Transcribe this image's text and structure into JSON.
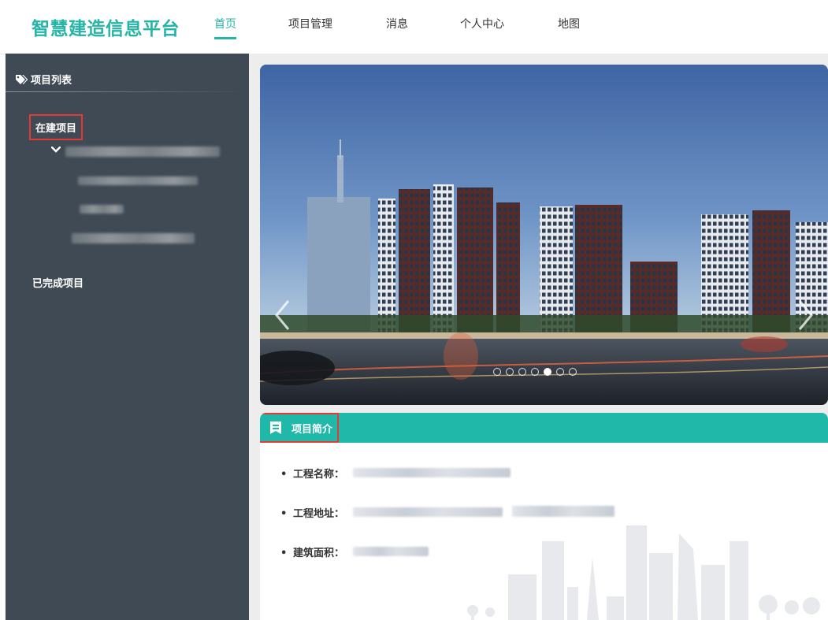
{
  "app": {
    "title": "智慧建造信息平台"
  },
  "nav": {
    "items": [
      {
        "label": "首页",
        "active": true
      },
      {
        "label": "项目管理"
      },
      {
        "label": "消息"
      },
      {
        "label": "个人中心"
      },
      {
        "label": "地图"
      }
    ]
  },
  "sidebar": {
    "header": {
      "label": "项目列表",
      "icon": "tag-icon"
    },
    "categories": [
      {
        "label": "在建项目",
        "highlighted": true,
        "expanded": true
      },
      {
        "label": "已完成项目"
      }
    ]
  },
  "carousel": {
    "slide_count": 7,
    "active_slide": 5,
    "prev_icon": "chevron-left-icon",
    "next_icon": "chevron-right-icon"
  },
  "intro": {
    "title": "项目简介",
    "icon": "bookmark-icon",
    "fields": [
      {
        "label": "工程名称："
      },
      {
        "label": "工程地址："
      },
      {
        "label": "建筑面积："
      }
    ]
  },
  "colors": {
    "accent": "#25b4a6",
    "sidebar": "#404a55",
    "highlight": "#e53935",
    "card_header": "#20b8a8"
  }
}
